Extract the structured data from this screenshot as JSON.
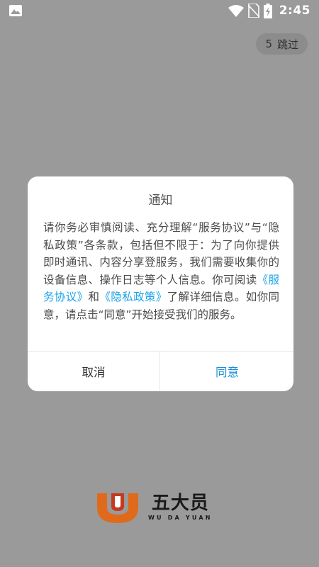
{
  "status_bar": {
    "time": "2:45",
    "icons": [
      "image-notification-icon",
      "wifi-icon",
      "no-sim-icon",
      "battery-charging-icon"
    ]
  },
  "skip": {
    "countdown": "5",
    "label": "跳过"
  },
  "dialog": {
    "title": "通知",
    "body_part1": "请你务必审慎阅读、充分理解“服务协议”与“隐私政策”各条款，包括但不限于：为了向你提供即时通讯、内容分享登服务，我们需要收集你的设备信息、操作日志等个人信息。你可阅读",
    "link_service": "《服务协议》",
    "body_and": "和",
    "link_privacy": "《隐私政策》",
    "body_part2": "了解详细信息。如你同意，请点击“同意”开始接受我们的服务。",
    "cancel_label": "取消",
    "agree_label": "同意"
  },
  "brand": {
    "name_cn": "五大员",
    "name_en": "WU DA YUAN"
  },
  "colors": {
    "overlay": "#9a9a9a",
    "link": "#1aa3e8",
    "agree": "#1a8fd6",
    "logo_orange": "#e06a1c",
    "logo_red": "#c43a1e"
  }
}
